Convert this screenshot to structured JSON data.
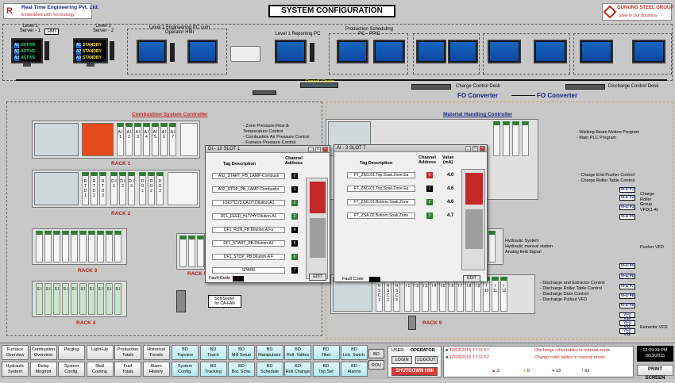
{
  "title": "SYSTEM CONFIGURATION",
  "logo_left": {
    "company": "Real Time Engineering Pvt. Ltd.",
    "tagline": "Embedded with Technology",
    "mark": "R"
  },
  "logo_right": {
    "company": "GUNUNG STEEL GROUP",
    "tagline": "Steel In Our Business"
  },
  "servers": {
    "server1_label": "Level 1\nServer - 1",
    "hmi_badge": "HMI",
    "server1_status": [
      {
        "k": "A1",
        "v": "ACTIVE"
      },
      {
        "k": "A2",
        "v": "ACTIVE"
      },
      {
        "k": "A3",
        "v": "ACTIVE"
      }
    ],
    "server2_label": "Level 1\nServer - 2",
    "server2_status": [
      {
        "k": "A1",
        "v": "STANDBY"
      },
      {
        "k": "A2",
        "v": "STANDBY"
      },
      {
        "k": "A3",
        "v": "STANDBY"
      }
    ]
  },
  "stations": {
    "eng_pc": "Level 1 Engineering PC cum\nOperator HMI",
    "reporting_pc": "Level 1 Reporting PC",
    "production_pc": "Production Scheduling\nPC - PPIC",
    "charge_desk": "Charge Control Desk",
    "discharge_desk": "Discharge Control Desk",
    "firewall": "Firewall / Router"
  },
  "fo_converter_1": "FO Converter",
  "fo_converter_2": "FO Converter",
  "combustion": {
    "title": "Combustion System Controller",
    "notes": [
      "- Zone Pressure,Flow &",
      "  Temperature Control",
      "- Combustion Air Pressure Control",
      "- Furnace Pressure Control"
    ],
    "rack1": "RACK 1",
    "rack2": "RACK 2",
    "rack3": "RACK 3",
    "rack4": "RACK 4",
    "rack5": "RACK 5",
    "soft_starter": "Soft Starter\nfor CA-FAN"
  },
  "material": {
    "title": "Material Handling Controller",
    "notes": [
      "- Walking Beam Motion Program",
      "- Main PLC Program"
    ],
    "pusher_notes": [
      "- Charge End Pusher Control",
      "- Charge Roller Table Control"
    ],
    "hydraulic_notes": [
      "Hydraulic System",
      "Hydraulic manual station",
      "Analog field Signal"
    ],
    "discharge_notes": [
      "- Discharge and Extractor Control",
      "- Discharge Roller Table Control",
      "- Discharge Door Control",
      "- Discharge Pullout VFD"
    ],
    "rack9": "RACK 9",
    "charge_roller": "Charge\nRoller\nGroup\nVFD(1-4)",
    "pusher_vfd": "Pusher VFD",
    "extractor_vfd": "Extractor VFD",
    "vfd_tags_top": [
      "VFD #1",
      "VFD #2",
      "VFD #3",
      "VFD #4"
    ],
    "vfd_tags_bottom": [
      "VFD #5",
      "VFD #6",
      "VFD #7",
      "VFD #8",
      "VFD #9",
      "VFD #10",
      "VFD #11",
      "VFD #12"
    ]
  },
  "di_popup": {
    "title": "DI - 10 SLOT 1",
    "col_tag": "Tag Description",
    "col_ch": "Channel\nAddress",
    "rows": [
      {
        "tag": "A02_START_PB_LAMP-Combusti",
        "ch": "0",
        "state": "off"
      },
      {
        "tag": "A02_STOP_PB_LAMP-Combustio",
        "ch": "1",
        "state": "off"
      },
      {
        "tag": "LSCITCV3.CA.07.Dilution.A1",
        "ch": "2",
        "state": "on"
      },
      {
        "tag": "DF1_FEED_HLT/HY.Dilution.A1",
        "ch": "3",
        "state": "on"
      },
      {
        "tag": "DF1_RUN_FB.Dilution.A Fa",
        "ch": "4",
        "state": "off"
      },
      {
        "tag": "DF1_START_PB.Dilution.A1",
        "ch": "5",
        "state": "off"
      },
      {
        "tag": "DF1_STOP_PB.Dilution.A F",
        "ch": "6",
        "state": "on"
      },
      {
        "tag": "SPARE",
        "ch": "7",
        "state": "off"
      }
    ],
    "fault_label": "Fault Code",
    "fault_value": "0",
    "edit": "EDIT"
  },
  "ai_popup": {
    "title": "AI - 3 SLOT 7",
    "col_tag": "Tag Description",
    "col_ch": "Channel\nAddress",
    "col_val": "Value\n(mA)",
    "rows": [
      {
        "tag": "FT_ZSG.01.Top.Soak.Zone.Ea",
        "ch": "0",
        "val": "4.0",
        "state": "red"
      },
      {
        "tag": "FT_ZSG.01.Top.Soak.Zone.Ea",
        "ch": "1",
        "val": "4.6",
        "state": "off"
      },
      {
        "tag": "FT_ZSG.01.Bottom.Soak.Zone",
        "ch": "2",
        "val": "4.6",
        "state": "on"
      },
      {
        "tag": "FT_ZSA.02.Bottom.Soak.Zone",
        "ch": "3",
        "val": "4.7",
        "state": "on"
      }
    ],
    "fault_label": "Fault Code",
    "edit": "EDIT"
  },
  "nav_row1": [
    "Furnace\nOverview",
    "Combustion\nOverview",
    "Purging",
    "Light-Up",
    "Production\nTotals",
    "Historical\nTrends"
  ],
  "nav_row2": [
    "Hydraulic\nSystem",
    "Delay\nMngmnt",
    "System\nConfig.",
    "Skid\nCooling",
    "Fuel\nTotals",
    "Alarm\nHistory"
  ],
  "bd_row1": [
    "BD\nTopview",
    "BD\nTeach",
    "BD\nMill Setup",
    "BD\nManipulator",
    "BD\nRoll. Tables",
    "BD\nTilter",
    "BD\nLmt. Swtch."
  ],
  "bd_row2": [
    "System\nConfig.",
    "BD\nTracking",
    "BD\nBot. Scrw.",
    "BD\nSchedule",
    "BD\nRoll Change",
    "BD\nTop Set",
    "BD\nAlarms"
  ],
  "bd_btn": "BD",
  "rou_btn": "ROU",
  "user_label": "USER:",
  "user_value": "OPERATOR",
  "login": "LOGIN",
  "logout": "LOGOUT",
  "shutdown": "SHUTDOWN HMI",
  "alarms": [
    {
      "dt": "12/03/2015  17:11:57",
      "msg": "Discharge roller tables in manual mode"
    },
    {
      "dt": "12/03/2015  17:11:57",
      "msg": "Charge roller tables in manual mode"
    }
  ],
  "alarm_counts": [
    "2",
    "0",
    "13",
    "93"
  ],
  "clock_time": "12:09:34 PM",
  "clock_date": "9/13/2015",
  "print_screen": "PRINT SCREEN"
}
